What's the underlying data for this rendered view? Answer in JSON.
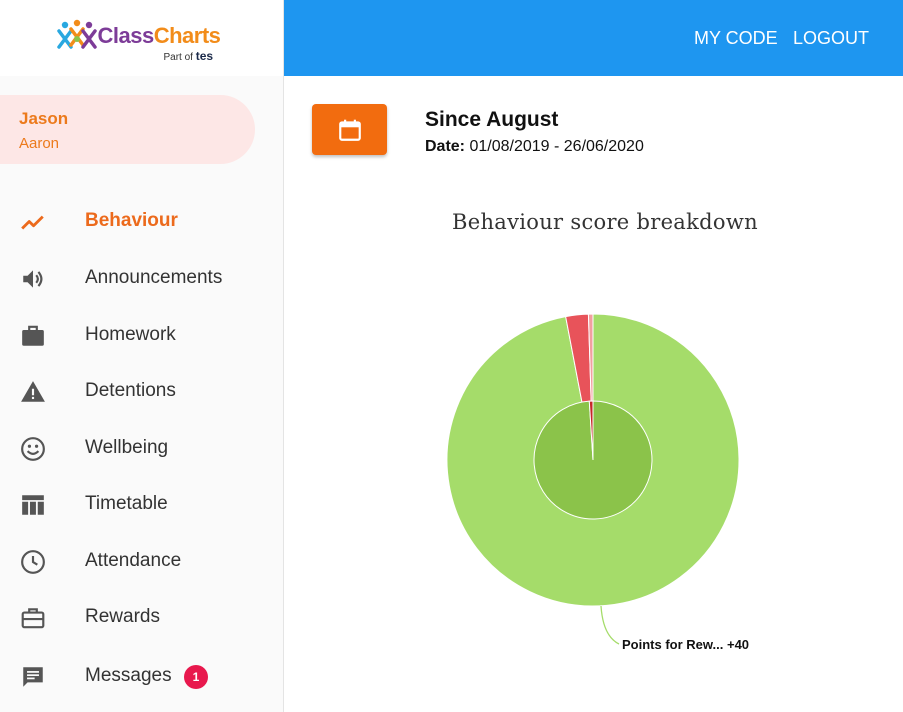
{
  "logo": {
    "brand_part1": "Class",
    "brand_part2": "Charts",
    "tagline_prefix": "Part of",
    "tagline_brand": "tes"
  },
  "student": {
    "first_name": "Jason",
    "last_name": "Aaron"
  },
  "nav": [
    {
      "label": "Behaviour",
      "icon": "trending-up-icon",
      "active": true
    },
    {
      "label": "Announcements",
      "icon": "speaker-icon",
      "active": false
    },
    {
      "label": "Homework",
      "icon": "briefcase-icon",
      "active": false
    },
    {
      "label": "Detentions",
      "icon": "warning-icon",
      "active": false
    },
    {
      "label": "Wellbeing",
      "icon": "smiley-icon",
      "active": false
    },
    {
      "label": "Timetable",
      "icon": "table-icon",
      "active": false
    },
    {
      "label": "Attendance",
      "icon": "clock-icon",
      "active": false
    },
    {
      "label": "Rewards",
      "icon": "toolbox-icon",
      "active": false
    },
    {
      "label": "Messages",
      "icon": "chat-icon",
      "active": false,
      "badge": "1"
    }
  ],
  "header": {
    "my_code": "MY CODE",
    "logout": "LOGOUT"
  },
  "range": {
    "title": "Since August",
    "date_label": "Date:",
    "date_value": "01/08/2019 - 26/06/2020",
    "calendar_icon": "calendar-icon"
  },
  "colors": {
    "primary_orange": "#f26c0f",
    "header_blue": "#1e96f0",
    "positive_green": "#a5dc6a",
    "inner_green": "#8bc34a",
    "negative_red": "#e8535a",
    "badge_red": "#e8184d"
  },
  "chart_data": {
    "type": "pie",
    "title": "Behaviour score breakdown",
    "outer_ring": [
      {
        "label": "Points for Rew... +40",
        "value": 97,
        "color": "#a5dc6a"
      },
      {
        "value": 2.5,
        "color": "#e8535a"
      },
      {
        "value": 0.5,
        "color": "#f2a0a0"
      }
    ],
    "inner_pie": [
      {
        "value": 99,
        "color": "#8bc34a"
      },
      {
        "value": 1,
        "color": "#c62828"
      }
    ]
  }
}
